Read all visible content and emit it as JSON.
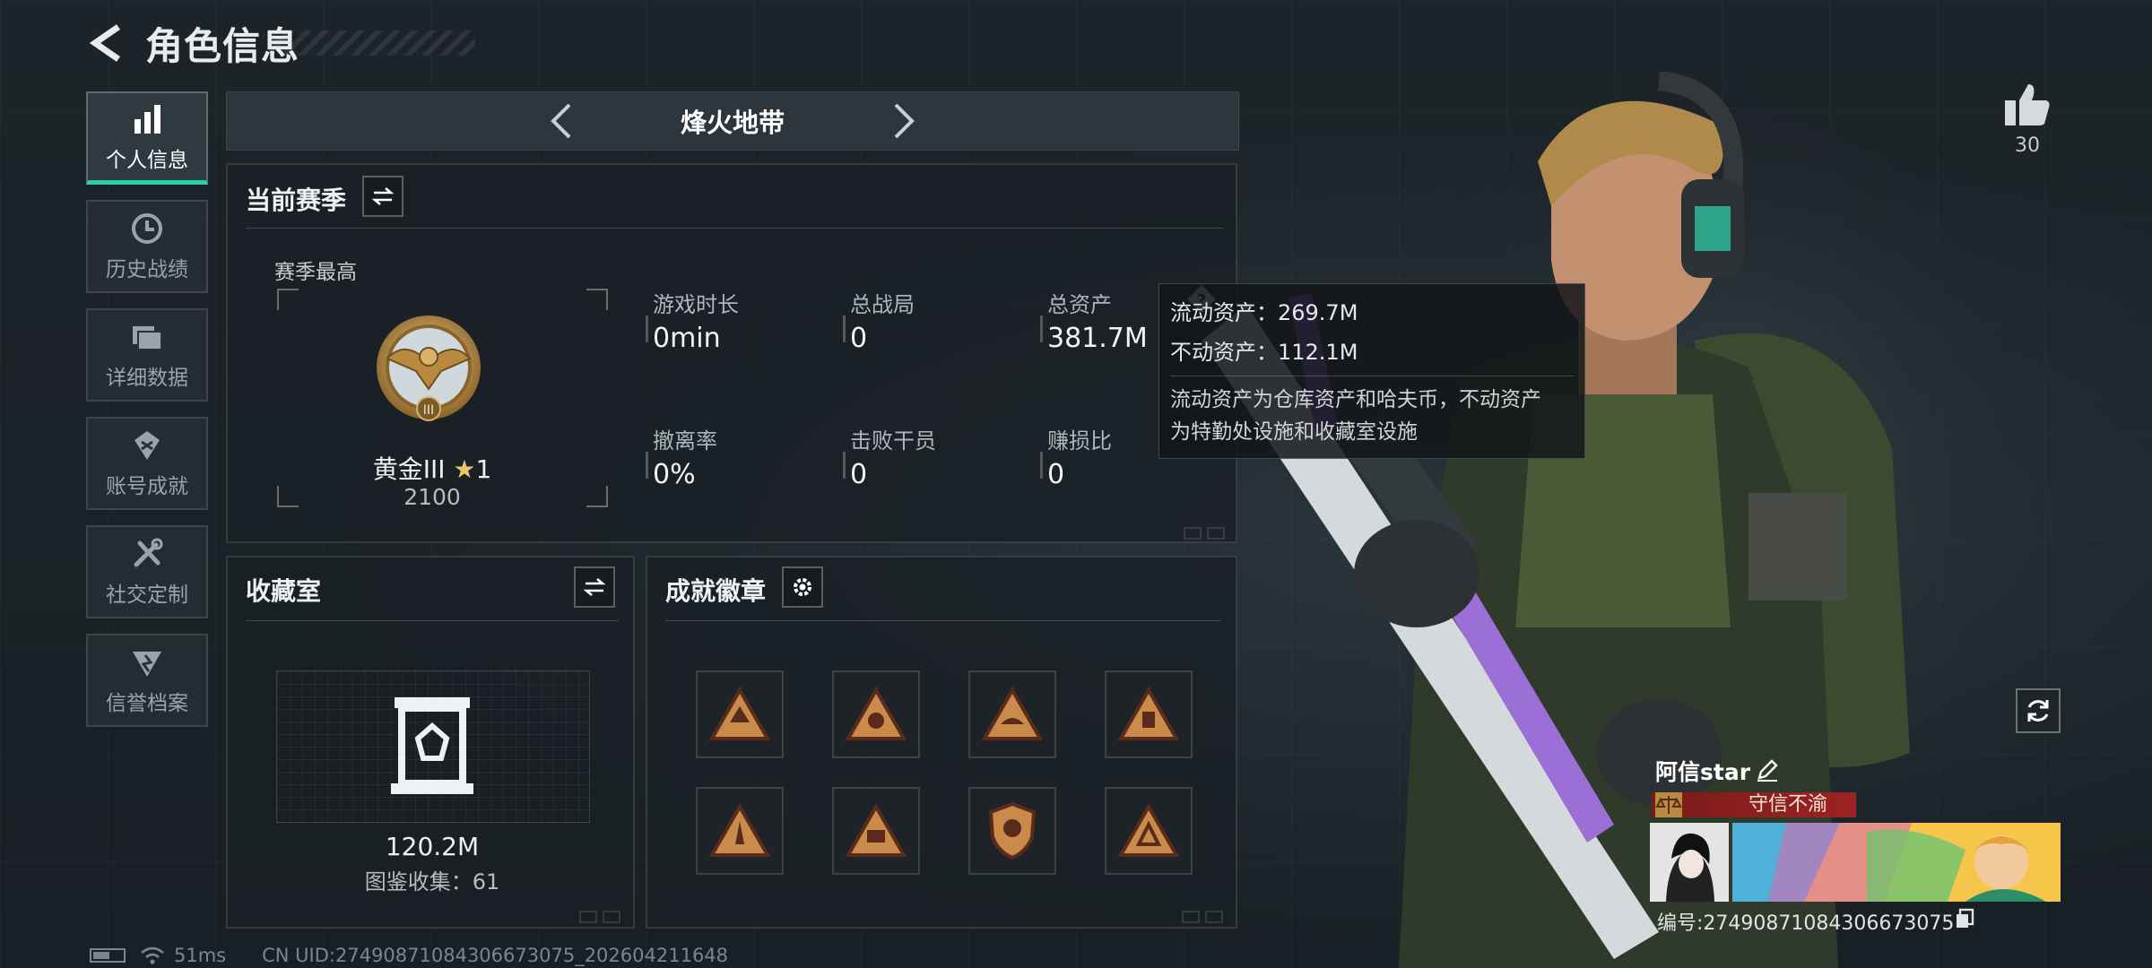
{
  "header": {
    "title": "角色信息"
  },
  "nav": [
    {
      "label": "个人信息",
      "icon": "bar-chart-icon",
      "active": true
    },
    {
      "label": "历史战绩",
      "icon": "clock-icon",
      "active": false
    },
    {
      "label": "详细数据",
      "icon": "folder-icon",
      "active": false
    },
    {
      "label": "账号成就",
      "icon": "achievement-icon",
      "active": false
    },
    {
      "label": "社交定制",
      "icon": "tools-icon",
      "active": false
    },
    {
      "label": "信誉档案",
      "icon": "credit-icon",
      "active": false
    }
  ],
  "mode": {
    "title": "烽火地带"
  },
  "season": {
    "title": "当前赛季",
    "best_label": "赛季最高",
    "rank_name": "黄金III",
    "rank_stars": "1",
    "rank_points": "2100",
    "stats": [
      {
        "label": "游戏时长",
        "value": "0min"
      },
      {
        "label": "总战局",
        "value": "0"
      },
      {
        "label": "总资产",
        "value": "381.7M"
      },
      {
        "label": "撤离率",
        "value": "0%"
      },
      {
        "label": "击败干员",
        "value": "0"
      },
      {
        "label": "赚损比",
        "value": "0"
      }
    ]
  },
  "tooltip": {
    "liquid": "流动资产：269.7M",
    "fixed": "不动资产：112.1M",
    "desc_line1": "流动资产为仓库资产和哈夫币，不动资产",
    "desc_line2": "为特勤处设施和收藏室设施"
  },
  "collection": {
    "title": "收藏室",
    "value": "120.2M",
    "catalog": "图鉴收集：61"
  },
  "badges": {
    "title": "成就徽章"
  },
  "like": {
    "count": "30"
  },
  "player": {
    "name": "阿信star",
    "title_tag": "守信不渝",
    "uid": "编号:27490871084306673075"
  },
  "status": {
    "latency": "51ms",
    "uid": "CN UID:27490871084306673075_202604211648"
  },
  "colors": {
    "accent": "#29d3a0",
    "tag": "#9c2323"
  }
}
